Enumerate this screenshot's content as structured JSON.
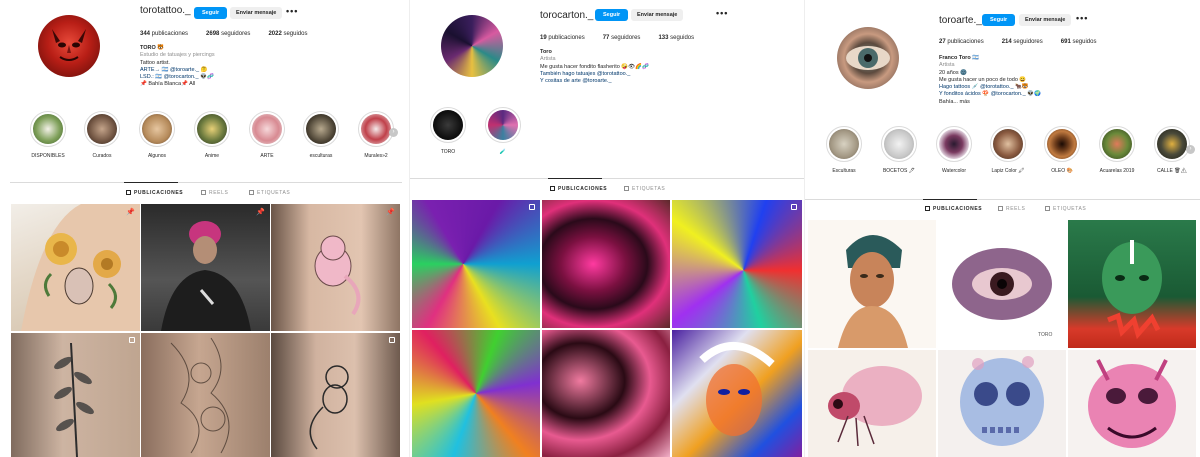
{
  "panels": [
    {
      "username": "torotattoo._",
      "follow_label": "Seguir",
      "message_label": "Enviar mensaje",
      "more_label": "•••",
      "stats": [
        {
          "count": "344",
          "label": " publicaciones"
        },
        {
          "count": "2698",
          "label": " seguidores"
        },
        {
          "count": "2022",
          "label": " seguidos"
        }
      ],
      "bio": {
        "name": "TORO 🐯",
        "category": "Estudio de tatuajes y piercings",
        "lines": [
          "Tattoo artist.",
          "ARTE→ 🇦🇷 @toroarte._ 🤔",
          "LSD.: 🇦🇷 @torocarton._ 👽🧬",
          "📌 Bahía Blanca📌 All"
        ]
      },
      "highlights": [
        "DISPONIBLES",
        "Curados",
        "Algunos",
        "Anime",
        "ARTE",
        "esculturas",
        "Murales»2"
      ],
      "tabs": [
        "PUBLICACIONES",
        "REELS",
        "ETIQUETAS"
      ],
      "posts": [
        "tattoo-roses-woman",
        "tattoo-artist-working",
        "tattoo-pink-mew-arm",
        "tattoo-botanical-leg",
        "tattoo-sleeve-sketch",
        "tattoo-mew-outline-leg"
      ]
    },
    {
      "username": "torocarton._",
      "follow_label": "Seguir",
      "message_label": "Enviar mensaje",
      "more_label": "•••",
      "stats": [
        {
          "count": "19",
          "label": " publicaciones"
        },
        {
          "count": "77",
          "label": " seguidores"
        },
        {
          "count": "133",
          "label": " seguidos"
        }
      ],
      "bio": {
        "name": "Toro",
        "category": "Artista",
        "lines": [
          "Me gusta hacer fondito flasherito 🤪👁🌈🧬",
          "También hago tatuajes @torotattoo._",
          "Y cositas de arte @toroarte._"
        ]
      },
      "highlights": [
        "TORO",
        "🧪"
      ],
      "tabs": [
        "PUBLICACIONES",
        "ETIQUETAS"
      ],
      "posts": [
        "psy-marble-colors",
        "psy-pink-swirl",
        "psy-glitch-pattern",
        "psy-rainbow-swirl",
        "psy-pink-waves",
        "psy-face-portrait"
      ]
    },
    {
      "username": "toroarte._",
      "follow_label": "Seguir",
      "message_label": "Enviar mensaje",
      "more_label": "•••",
      "stats": [
        {
          "count": "27",
          "label": " publicaciones"
        },
        {
          "count": "214",
          "label": " seguidores"
        },
        {
          "count": "691",
          "label": " seguidos"
        }
      ],
      "bio": {
        "name": "Franco Toro 🇦🇷",
        "category": "Artista",
        "lines": [
          "20 años 🌚",
          "Me gusta hacer un poco de todo 😄",
          "Hago tattoos 💉 @torotattoo._ 🐂🐯",
          "Y fonditos ácidos 🍄 @torocarton._ 👽🌍",
          "Bahía... más"
        ]
      },
      "highlights": [
        "Esculturas",
        "BOCETOS 🖊",
        "Watercolor",
        "Lapiz Color 🖍",
        "OLEO 🎨",
        "Acuarelas 2019",
        "CALLE 🗑⚠"
      ],
      "tabs": [
        "PUBLICACIONES",
        "REELS",
        "ETIQUETAS"
      ],
      "posts": [
        "art-woman-headscarf",
        "art-eye-watercolor",
        "art-green-face",
        "art-pink-fly",
        "art-skull-blue",
        "art-pink-creature"
      ]
    }
  ],
  "post_signature": "TORO"
}
